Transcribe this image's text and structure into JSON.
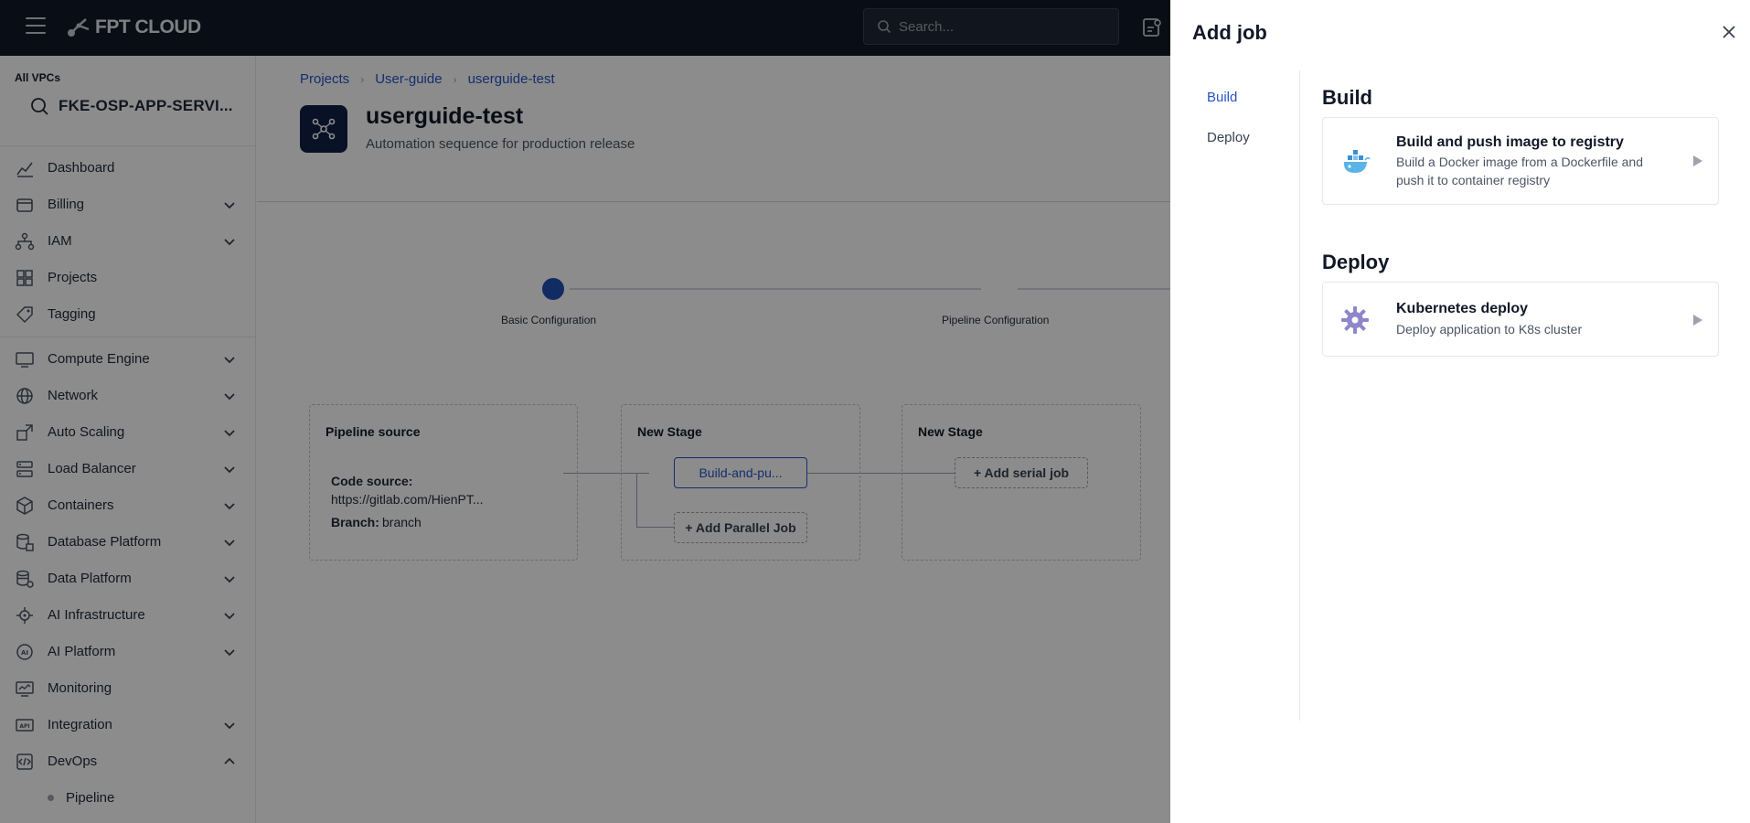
{
  "topbar": {
    "logo_text": "FPT CLOUD",
    "search_placeholder": "Search..."
  },
  "sidebar": {
    "vpc_label": "All VPCs",
    "vpc_name": "FKE-OSP-APP-SERVI...",
    "items": [
      {
        "label": "Dashboard",
        "icon": "chart-icon",
        "expandable": false
      },
      {
        "label": "Billing",
        "icon": "wallet-icon",
        "expandable": true
      },
      {
        "label": "IAM",
        "icon": "hierarchy-icon",
        "expandable": true
      },
      {
        "label": "Projects",
        "icon": "projects-icon",
        "expandable": false
      },
      {
        "label": "Tagging",
        "icon": "tag-icon",
        "expandable": false
      },
      {
        "label": "Compute Engine",
        "icon": "monitor-icon",
        "expandable": true
      },
      {
        "label": "Network",
        "icon": "globe-icon",
        "expandable": true
      },
      {
        "label": "Auto Scaling",
        "icon": "scaling-icon",
        "expandable": true
      },
      {
        "label": "Load Balancer",
        "icon": "balancer-icon",
        "expandable": true
      },
      {
        "label": "Containers",
        "icon": "container-icon",
        "expandable": true
      },
      {
        "label": "Database Platform",
        "icon": "database-icon",
        "expandable": true
      },
      {
        "label": "Data Platform",
        "icon": "data-platform-icon",
        "expandable": true
      },
      {
        "label": "AI Infrastructure",
        "icon": "ai-infra-icon",
        "expandable": true
      },
      {
        "label": "AI Platform",
        "icon": "ai-platform-icon",
        "expandable": true
      },
      {
        "label": "Monitoring",
        "icon": "monitoring-icon",
        "expandable": false
      },
      {
        "label": "Integration",
        "icon": "api-icon",
        "expandable": true
      },
      {
        "label": "DevOps",
        "icon": "devops-icon",
        "expandable": true,
        "expanded": true
      }
    ],
    "subitems": [
      {
        "label": "Pipeline"
      }
    ]
  },
  "main": {
    "breadcrumb": [
      "Projects",
      "User-guide",
      "userguide-test"
    ],
    "project_title": "userguide-test",
    "project_desc": "Automation sequence for production release",
    "steps": [
      "Basic Configuration",
      "Pipeline Configuration"
    ],
    "pipeline_source": {
      "title": "Pipeline source",
      "code_source_label": "Code source:",
      "code_source_value": "https://gitlab.com/HienPT...",
      "branch_label": "Branch:",
      "branch_value": "branch"
    },
    "stages": [
      {
        "title": "New Stage",
        "job": "Build-and-pu...",
        "parallel_button": "+ Add Parallel Job"
      },
      {
        "title": "New Stage",
        "serial_button": "+ Add serial job"
      }
    ]
  },
  "drawer": {
    "title": "Add job",
    "tabs": [
      "Build",
      "Deploy"
    ],
    "active_tab": "Build",
    "sections": [
      {
        "title": "Build",
        "cards": [
          {
            "name": "Build and push image to registry",
            "desc": "Build a Docker image from a Dockerfile and push it to container registry",
            "icon": "docker-icon"
          }
        ]
      },
      {
        "title": "Deploy",
        "cards": [
          {
            "name": "Kubernetes deploy",
            "desc": "Deploy application to K8s cluster",
            "icon": "gear-icon"
          }
        ]
      }
    ]
  },
  "colors": {
    "topbar_bg": "#111827",
    "accent": "#2454c6",
    "stepper_active": "#1f4fb5",
    "overlay": "rgba(0,0,0,0.45)"
  }
}
